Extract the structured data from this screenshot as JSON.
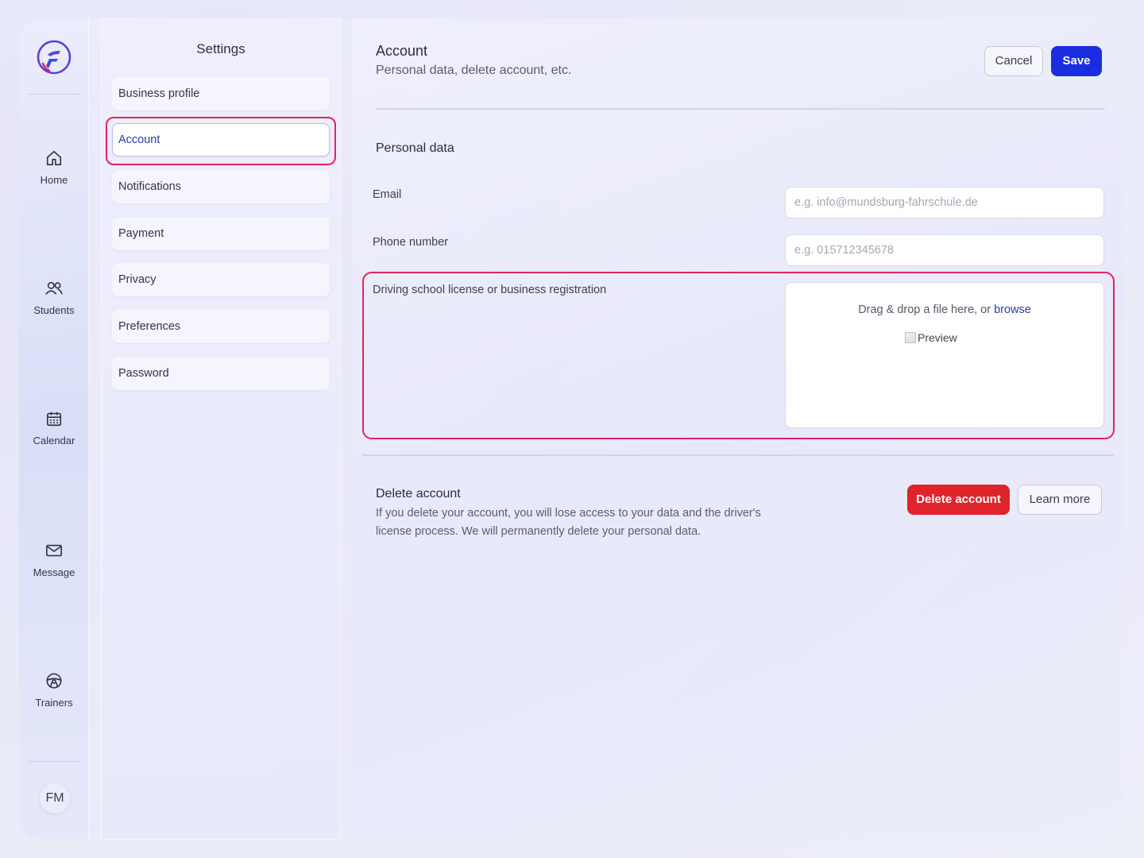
{
  "nav": {
    "items": [
      {
        "label": "Home",
        "icon": "home-icon"
      },
      {
        "label": "Students",
        "icon": "users-icon"
      },
      {
        "label": "Calendar",
        "icon": "calendar-icon"
      },
      {
        "label": "Message",
        "icon": "mail-icon"
      },
      {
        "label": "Trainers",
        "icon": "steering-wheel-icon"
      }
    ],
    "avatar": "FM"
  },
  "settings": {
    "title": "Settings",
    "items": [
      {
        "label": "Business profile"
      },
      {
        "label": "Account",
        "active": true
      },
      {
        "label": "Notifications"
      },
      {
        "label": "Payment"
      },
      {
        "label": "Privacy"
      },
      {
        "label": "Preferences"
      },
      {
        "label": "Password"
      }
    ]
  },
  "header": {
    "title": "Account",
    "subtitle": "Personal data, delete account, etc.",
    "cancel_label": "Cancel",
    "save_label": "Save"
  },
  "personal_data": {
    "title": "Personal data",
    "email_label": "Email",
    "email_placeholder": "e.g. info@mundsburg-fahrschule.de",
    "phone_label": "Phone number",
    "phone_placeholder": "e.g. 015712345678",
    "license_label": "Driving school license or business registration",
    "dropzone_text": "Drag & drop a file here, or ",
    "dropzone_link": "browse",
    "preview_alt": "Preview"
  },
  "delete_account": {
    "title": "Delete account",
    "description": "If you delete your account, you will lose access to your data and the driver's license process. We will permanently delete your personal data.",
    "delete_label": "Delete account",
    "learn_more_label": "Learn more"
  },
  "colors": {
    "primary": "#1a2ee0",
    "danger": "#e0242c",
    "highlight": "#e0245e"
  }
}
